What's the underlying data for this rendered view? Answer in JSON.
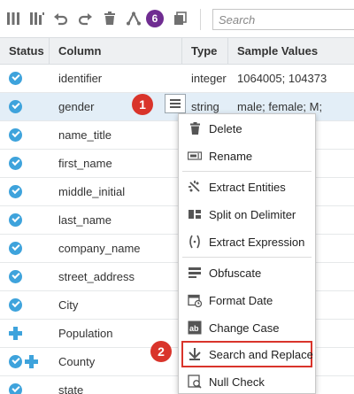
{
  "toolbar": {
    "badge_count": "6",
    "search_placeholder": "Search",
    "icons": [
      "columns-icon",
      "columns-split-icon",
      "undo-icon",
      "redo-icon",
      "trash-icon",
      "recommendations-icon",
      "copy-icon"
    ]
  },
  "table": {
    "headers": {
      "status": "Status",
      "column": "Column",
      "type": "Type",
      "sample": "Sample Values"
    },
    "rows": [
      {
        "status": "check",
        "column": "identifier",
        "type": "integer",
        "sample": "1064005; 104373"
      },
      {
        "status": "check",
        "column": "gender",
        "type": "string",
        "sample": "male; female; M;"
      },
      {
        "status": "check",
        "column": "name_title",
        "type": "",
        "sample": ""
      },
      {
        "status": "check",
        "column": "first_name",
        "type": "",
        "sample": ""
      },
      {
        "status": "check",
        "column": "middle_initial",
        "type": "",
        "sample": ""
      },
      {
        "status": "check",
        "column": "last_name",
        "type": "",
        "sample": ""
      },
      {
        "status": "check",
        "column": "company_name",
        "type": "",
        "sample": ""
      },
      {
        "status": "check",
        "column": "street_address",
        "type": "",
        "sample": ""
      },
      {
        "status": "check",
        "column": "City",
        "type": "",
        "sample": ""
      },
      {
        "status": "plus",
        "column": "Population",
        "type": "",
        "sample": ""
      },
      {
        "status": "check-plus",
        "column": "County",
        "type": "",
        "sample": ""
      },
      {
        "status": "check",
        "column": "state",
        "type": "",
        "sample": ""
      }
    ]
  },
  "callouts": {
    "one": "1",
    "two": "2"
  },
  "menu": {
    "items": [
      {
        "label": "Delete",
        "icon": "trash-icon"
      },
      {
        "label": "Rename",
        "icon": "rename-icon"
      },
      {
        "label": "Extract Entities",
        "icon": "extract-entities-icon"
      },
      {
        "label": "Split on Delimiter",
        "icon": "split-delimiter-icon"
      },
      {
        "label": "Extract Expression",
        "icon": "extract-expression-icon"
      },
      {
        "label": "Obfuscate",
        "icon": "obfuscate-icon"
      },
      {
        "label": "Format Date",
        "icon": "calendar-icon"
      },
      {
        "label": "Change Case",
        "icon": "change-case-icon"
      },
      {
        "label": "Search and Replace",
        "icon": "search-replace-icon"
      },
      {
        "label": "Null Check",
        "icon": "null-check-icon"
      }
    ],
    "highlighted_item": "Search and Replace"
  },
  "colors": {
    "accent": "#3ea3dc",
    "badge": "#6f2c91",
    "callout": "#d9342b",
    "selected_row": "#e3eef7"
  }
}
